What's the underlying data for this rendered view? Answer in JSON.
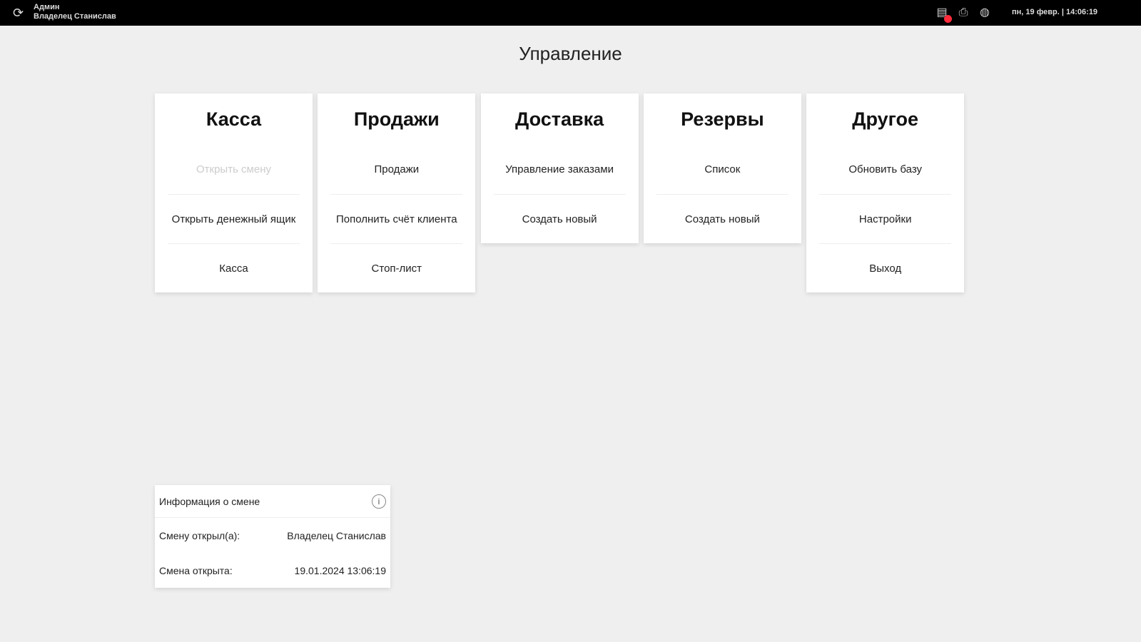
{
  "topbar": {
    "role": "Админ",
    "user": "Владелец Станислав",
    "datetime": "пн, 19 февр. | 14:06:19"
  },
  "page_title": "Управление",
  "cards": [
    {
      "title": "Касса",
      "items": [
        {
          "label": "Открыть смену",
          "disabled": true
        },
        {
          "label": "Открыть денежный ящик"
        },
        {
          "label": "Касса"
        }
      ]
    },
    {
      "title": "Продажи",
      "items": [
        {
          "label": "Продажи"
        },
        {
          "label": "Пополнить счёт клиента"
        },
        {
          "label": "Стоп-лист"
        }
      ]
    },
    {
      "title": "Доставка",
      "items": [
        {
          "label": "Управление заказами"
        },
        {
          "label": "Создать новый"
        }
      ]
    },
    {
      "title": "Резервы",
      "items": [
        {
          "label": "Список"
        },
        {
          "label": "Создать новый"
        }
      ]
    },
    {
      "title": "Другое",
      "items": [
        {
          "label": "Обновить базу"
        },
        {
          "label": "Настройки"
        },
        {
          "label": "Выход"
        }
      ]
    }
  ],
  "shift_info": {
    "title": "Информация о смене",
    "opened_by_label": "Смену открыл(а):",
    "opened_by": "Владелец Станислав",
    "opened_at_label": "Смена открыта:",
    "opened_at": "19.01.2024 13:06:19"
  }
}
